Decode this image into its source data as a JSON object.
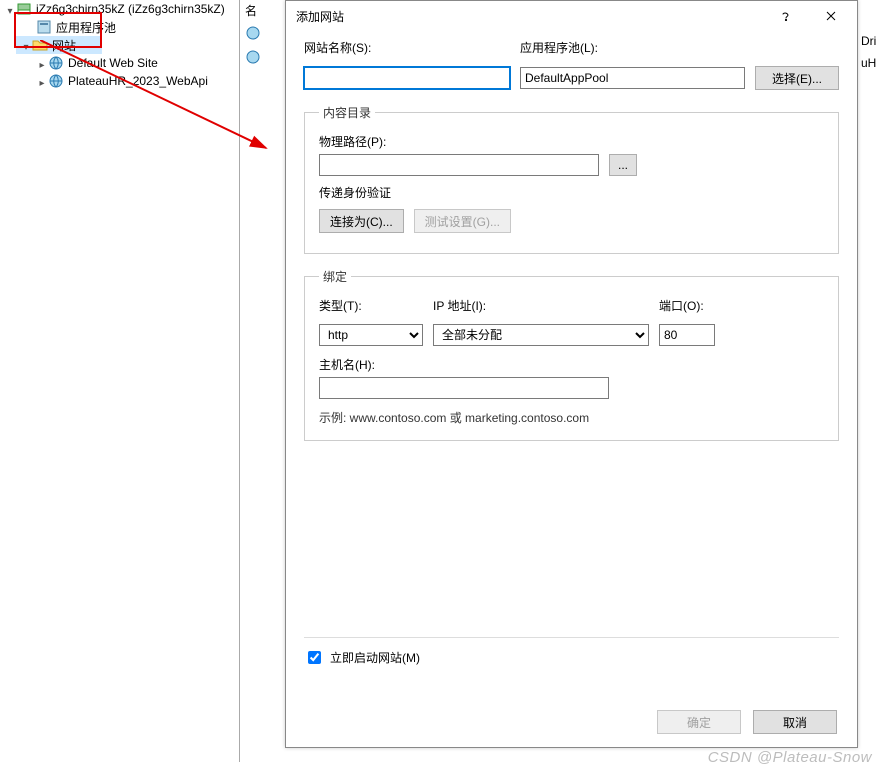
{
  "tree": {
    "root": {
      "label": "iZz6g3chirn35kZ (iZz6g3chirn35kZ)"
    },
    "pool": {
      "label": "应用程序池"
    },
    "sites": {
      "label": "网站"
    },
    "site1": {
      "label": "Default Web Site"
    },
    "site2": {
      "label": "PlateauHR_2023_WebApi"
    }
  },
  "inspector": {
    "header": "名"
  },
  "bg": {
    "l1": "Dri",
    "l2": "uH"
  },
  "dialog": {
    "title": "添加网站",
    "site_name_label": "网站名称(S):",
    "site_name_value": "",
    "app_pool_label": "应用程序池(L):",
    "app_pool_value": "DefaultAppPool",
    "select_btn": "选择(E)...",
    "content_group": "内容目录",
    "phys_path_label": "物理路径(P):",
    "phys_path_value": "",
    "browse_btn": "...",
    "auth_label": "传递身份验证",
    "connect_as_btn": "连接为(C)...",
    "test_settings_btn": "测试设置(G)...",
    "binding_group": "绑定",
    "type_label": "类型(T):",
    "type_value": "http",
    "ip_label": "IP 地址(I):",
    "ip_value": "全部未分配",
    "port_label": "端口(O):",
    "port_value": "80",
    "host_label": "主机名(H):",
    "host_value": "",
    "host_example": "示例: www.contoso.com 或 marketing.contoso.com",
    "start_now_label": "立即启动网站(M)",
    "ok_btn": "确定",
    "cancel_btn": "取消"
  },
  "watermark": "CSDN @Plateau-Snow"
}
